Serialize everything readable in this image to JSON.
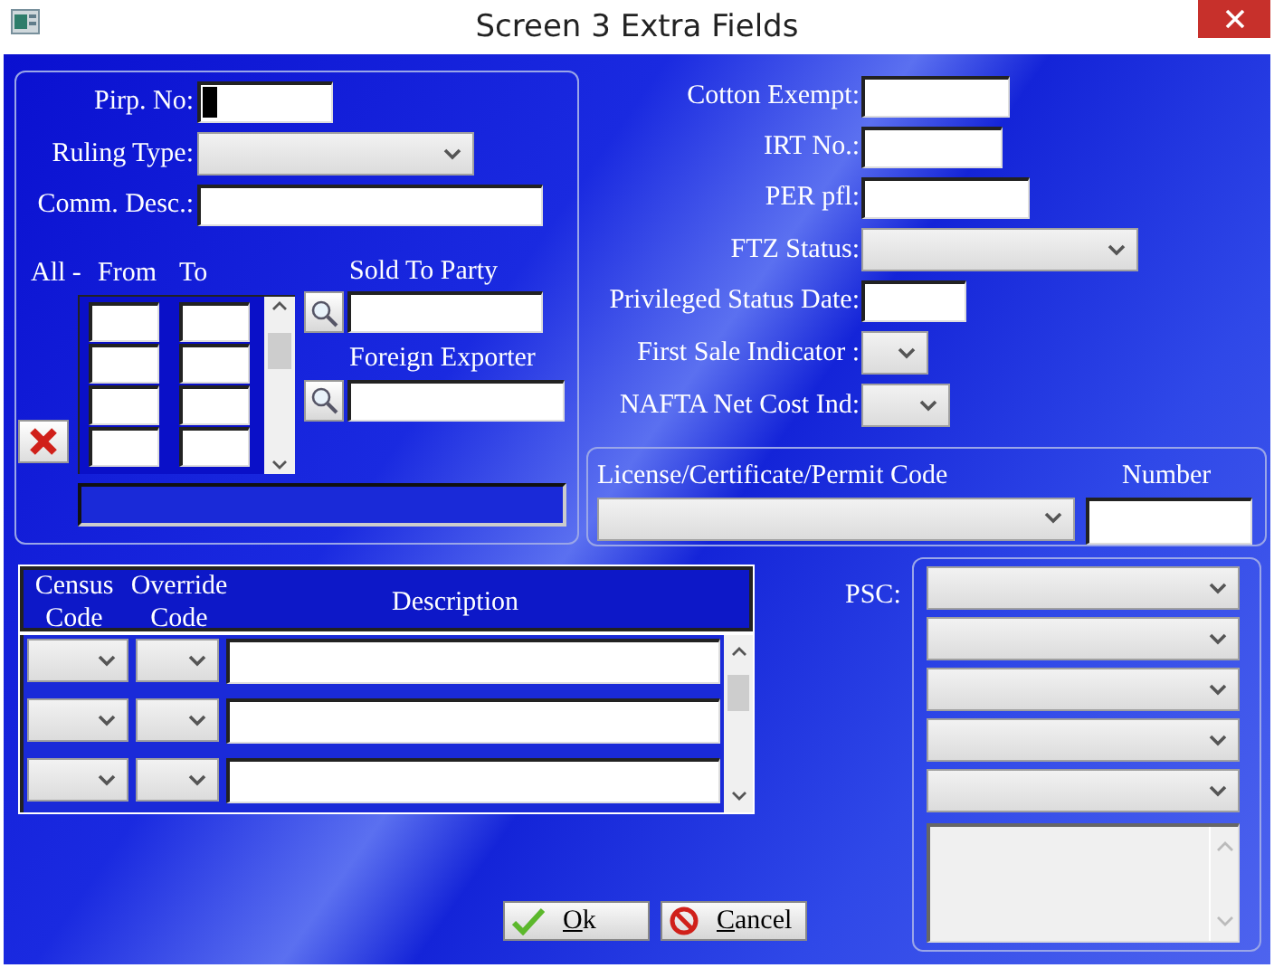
{
  "window": {
    "title": "Screen 3 Extra Fields"
  },
  "left_panel": {
    "fields": [
      {
        "label": "Pirp. No:",
        "kind": "text",
        "focused": true
      },
      {
        "label": "Ruling Type:",
        "kind": "select",
        "focused": false
      },
      {
        "label": "Comm. Desc.:",
        "kind": "text",
        "focused": false
      }
    ],
    "range_header": [
      "All -",
      "From",
      "To"
    ],
    "sold_to_label": "Sold To Party",
    "foreign_exporter_label": "Foreign Exporter"
  },
  "right_fields": [
    {
      "label": "Cotton Exempt:",
      "kind": "text"
    },
    {
      "label": "IRT No.:",
      "kind": "text"
    },
    {
      "label": "PER pfl:",
      "kind": "text"
    },
    {
      "label": "FTZ Status:",
      "kind": "select"
    },
    {
      "label": "Privileged Status Date:",
      "kind": "text"
    },
    {
      "label": "First Sale Indicator :",
      "kind": "select"
    },
    {
      "label": "NAFTA Net Cost Ind:",
      "kind": "select"
    }
  ],
  "license_panel": {
    "code_label": "License/Certificate/Permit Code",
    "number_label": "Number"
  },
  "census_table": {
    "columns": [
      "Census Code",
      "Override Code",
      "Description"
    ]
  },
  "psc_label": "PSC:",
  "buttons": [
    {
      "label": "Ok",
      "kind": "ok"
    },
    {
      "label": "Cancel",
      "kind": "cancel"
    }
  ]
}
